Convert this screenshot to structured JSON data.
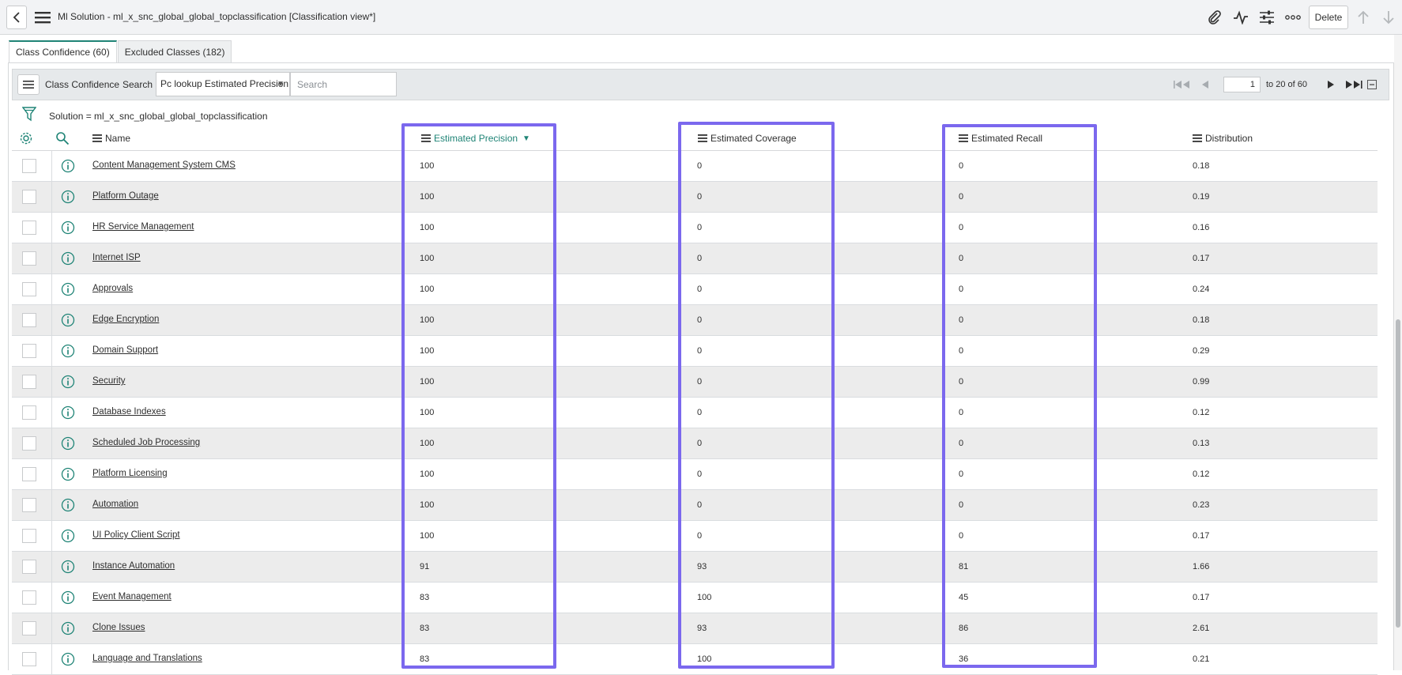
{
  "header": {
    "title": "Ml Solution - ml_x_snc_global_global_topclassification [Classification view*]",
    "delete_label": "Delete",
    "icons": [
      "back-icon",
      "menu-icon",
      "attachment-icon",
      "activity-icon",
      "settings-sliders-icon",
      "more-icon",
      "arrow-up-icon",
      "arrow-down-icon"
    ]
  },
  "tabs": [
    {
      "label": "Class Confidence (60)",
      "active": true
    },
    {
      "label": "Excluded Classes (182)",
      "active": false
    }
  ],
  "toolbar": {
    "list_title": "Class Confidence",
    "search_label": "Search",
    "search_field": "Pc lookup Estimated Precision",
    "search_placeholder": "Search",
    "page_input": "1",
    "page_total": "to 20 of 60"
  },
  "breadcrumb": "Solution = ml_x_snc_global_global_topclassification",
  "columns": {
    "name": "Name",
    "precision": "Estimated Precision",
    "coverage": "Estimated Coverage",
    "recall": "Estimated Recall",
    "distribution": "Distribution"
  },
  "rows": [
    {
      "name": "Content Management System CMS",
      "precision": "100",
      "coverage": "0",
      "recall": "0",
      "distribution": "0.18"
    },
    {
      "name": "Platform Outage",
      "precision": "100",
      "coverage": "0",
      "recall": "0",
      "distribution": "0.19"
    },
    {
      "name": "HR Service Management",
      "precision": "100",
      "coverage": "0",
      "recall": "0",
      "distribution": "0.16"
    },
    {
      "name": "Internet ISP",
      "precision": "100",
      "coverage": "0",
      "recall": "0",
      "distribution": "0.17"
    },
    {
      "name": "Approvals",
      "precision": "100",
      "coverage": "0",
      "recall": "0",
      "distribution": "0.24"
    },
    {
      "name": "Edge Encryption",
      "precision": "100",
      "coverage": "0",
      "recall": "0",
      "distribution": "0.18"
    },
    {
      "name": "Domain Support",
      "precision": "100",
      "coverage": "0",
      "recall": "0",
      "distribution": "0.29"
    },
    {
      "name": "Security",
      "precision": "100",
      "coverage": "0",
      "recall": "0",
      "distribution": "0.99"
    },
    {
      "name": "Database Indexes",
      "precision": "100",
      "coverage": "0",
      "recall": "0",
      "distribution": "0.12"
    },
    {
      "name": "Scheduled Job Processing",
      "precision": "100",
      "coverage": "0",
      "recall": "0",
      "distribution": "0.13"
    },
    {
      "name": "Platform Licensing",
      "precision": "100",
      "coverage": "0",
      "recall": "0",
      "distribution": "0.12"
    },
    {
      "name": "Automation",
      "precision": "100",
      "coverage": "0",
      "recall": "0",
      "distribution": "0.23"
    },
    {
      "name": "UI Policy Client Script",
      "precision": "100",
      "coverage": "0",
      "recall": "0",
      "distribution": "0.17"
    },
    {
      "name": "Instance Automation",
      "precision": "91",
      "coverage": "93",
      "recall": "81",
      "distribution": "1.66"
    },
    {
      "name": "Event Management",
      "precision": "83",
      "coverage": "100",
      "recall": "45",
      "distribution": "0.17"
    },
    {
      "name": "Clone Issues",
      "precision": "83",
      "coverage": "93",
      "recall": "86",
      "distribution": "2.61"
    },
    {
      "name": "Language and Translations",
      "precision": "83",
      "coverage": "100",
      "recall": "36",
      "distribution": "0.21"
    }
  ],
  "colors": {
    "accent": "#1f8476",
    "highlight": "#7b68ee",
    "row_alt": "#ececec"
  }
}
